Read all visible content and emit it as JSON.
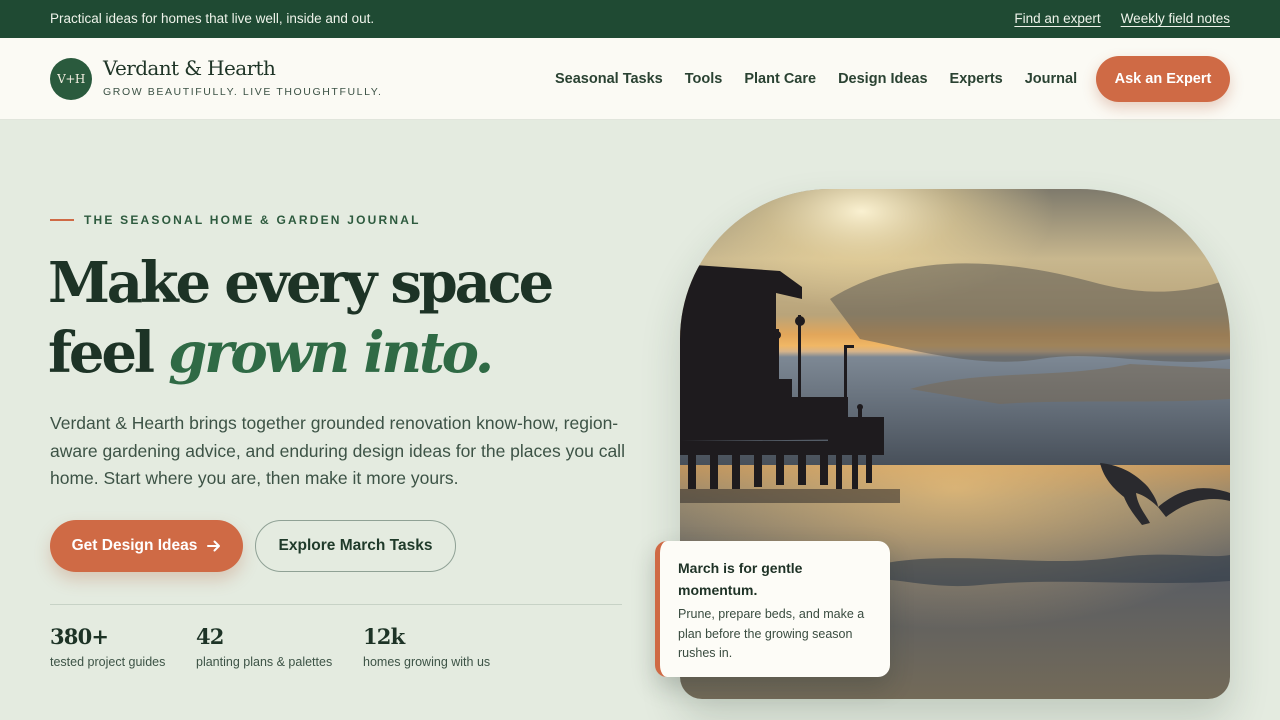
{
  "topbar": {
    "tagline": "Practical ideas for homes that live well, inside and out.",
    "links": [
      "Find an expert",
      "Weekly field notes"
    ]
  },
  "header": {
    "logo_initials": "V+H",
    "brand_name": "Verdant & Hearth",
    "brand_tagline": "GROW BEAUTIFULLY. LIVE THOUGHTFULLY.",
    "nav": [
      "Seasonal Tasks",
      "Tools",
      "Plant Care",
      "Design Ideas",
      "Experts",
      "Journal"
    ],
    "cta": "Ask an Expert"
  },
  "hero": {
    "eyebrow": "THE SEASONAL HOME & GARDEN JOURNAL",
    "headline_line1": "Make every space",
    "headline_line2_plain": "feel ",
    "headline_line2_emphasis": "grown into.",
    "lede": "Verdant & Hearth brings together grounded renovation know-how, region-aware gardening advice, and enduring design ideas for the places you call home. Start where you are, then make it more yours.",
    "primary_button": "Get Design Ideas",
    "primary_button_icon": "arrow-right-icon",
    "secondary_button": "Explore March Tasks",
    "stats": [
      {
        "value": "380+",
        "label": "tested project guides"
      },
      {
        "value": "42",
        "label": "planting plans & palettes"
      },
      {
        "value": "12k",
        "label": "homes growing with us"
      }
    ]
  },
  "note_card": {
    "title": "March is for gentle momentum.",
    "body": "Prune, prepare beds, and make a plan before the growing season rushes in."
  },
  "colors": {
    "brand_green": "#1f4a33",
    "accent": "#cf6a45",
    "background": "#e4ebe0"
  }
}
